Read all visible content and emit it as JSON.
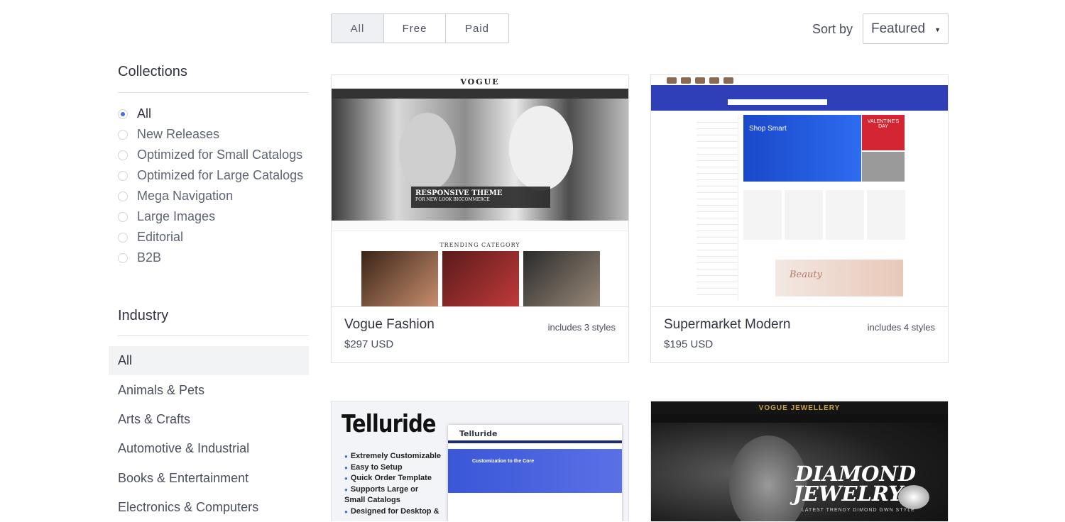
{
  "filters": {
    "all": "All",
    "free": "Free",
    "paid": "Paid"
  },
  "sort": {
    "label": "Sort by",
    "value": "Featured"
  },
  "collections": {
    "heading": "Collections",
    "items": [
      "All",
      "New Releases",
      "Optimized for Small Catalogs",
      "Optimized for Large Catalogs",
      "Mega Navigation",
      "Large Images",
      "Editorial",
      "B2B"
    ],
    "selected": "All"
  },
  "industry": {
    "heading": "Industry",
    "items": [
      "All",
      "Animals & Pets",
      "Arts & Crafts",
      "Automotive & Industrial",
      "Books & Entertainment",
      "Electronics & Computers"
    ],
    "selected": "All"
  },
  "themes": [
    {
      "name": "Vogue Fashion",
      "price": "$297 USD",
      "styles": "includes 3 styles",
      "thumb": {
        "brand": "VOGUE",
        "banner_title": "RESPONSIVE THEME",
        "banner_sub": "FOR NEW LOOK BIGCOMMERCE",
        "section": "TRENDING CATEGORY"
      }
    },
    {
      "name": "Supermarket Modern",
      "price": "$195 USD",
      "styles": "includes 4 styles",
      "thumb": {
        "hero": "Shop Smart",
        "promo": "VALENTINE'S DAY",
        "beauty": "Beauty"
      }
    },
    {
      "thumb": {
        "brand": "Telluride",
        "features": [
          "Extremely Customizable",
          "Easy to Setup",
          "Quick Order Template",
          "Supports Large or Small Catalogs",
          "Designed for Desktop &"
        ],
        "hero": "Customization to the Core"
      }
    },
    {
      "thumb": {
        "brand": "VOGUE JEWELLERY",
        "title_line1": "DIAMOND",
        "title_line2": "JEWELRYS",
        "tagline": "LATEST TRENDY DIMOND GWN STYLE"
      }
    }
  ],
  "colors": {
    "accent": "#4a6ee0",
    "border": "#dfe1e6",
    "selected_bg": "#f2f3f5"
  }
}
